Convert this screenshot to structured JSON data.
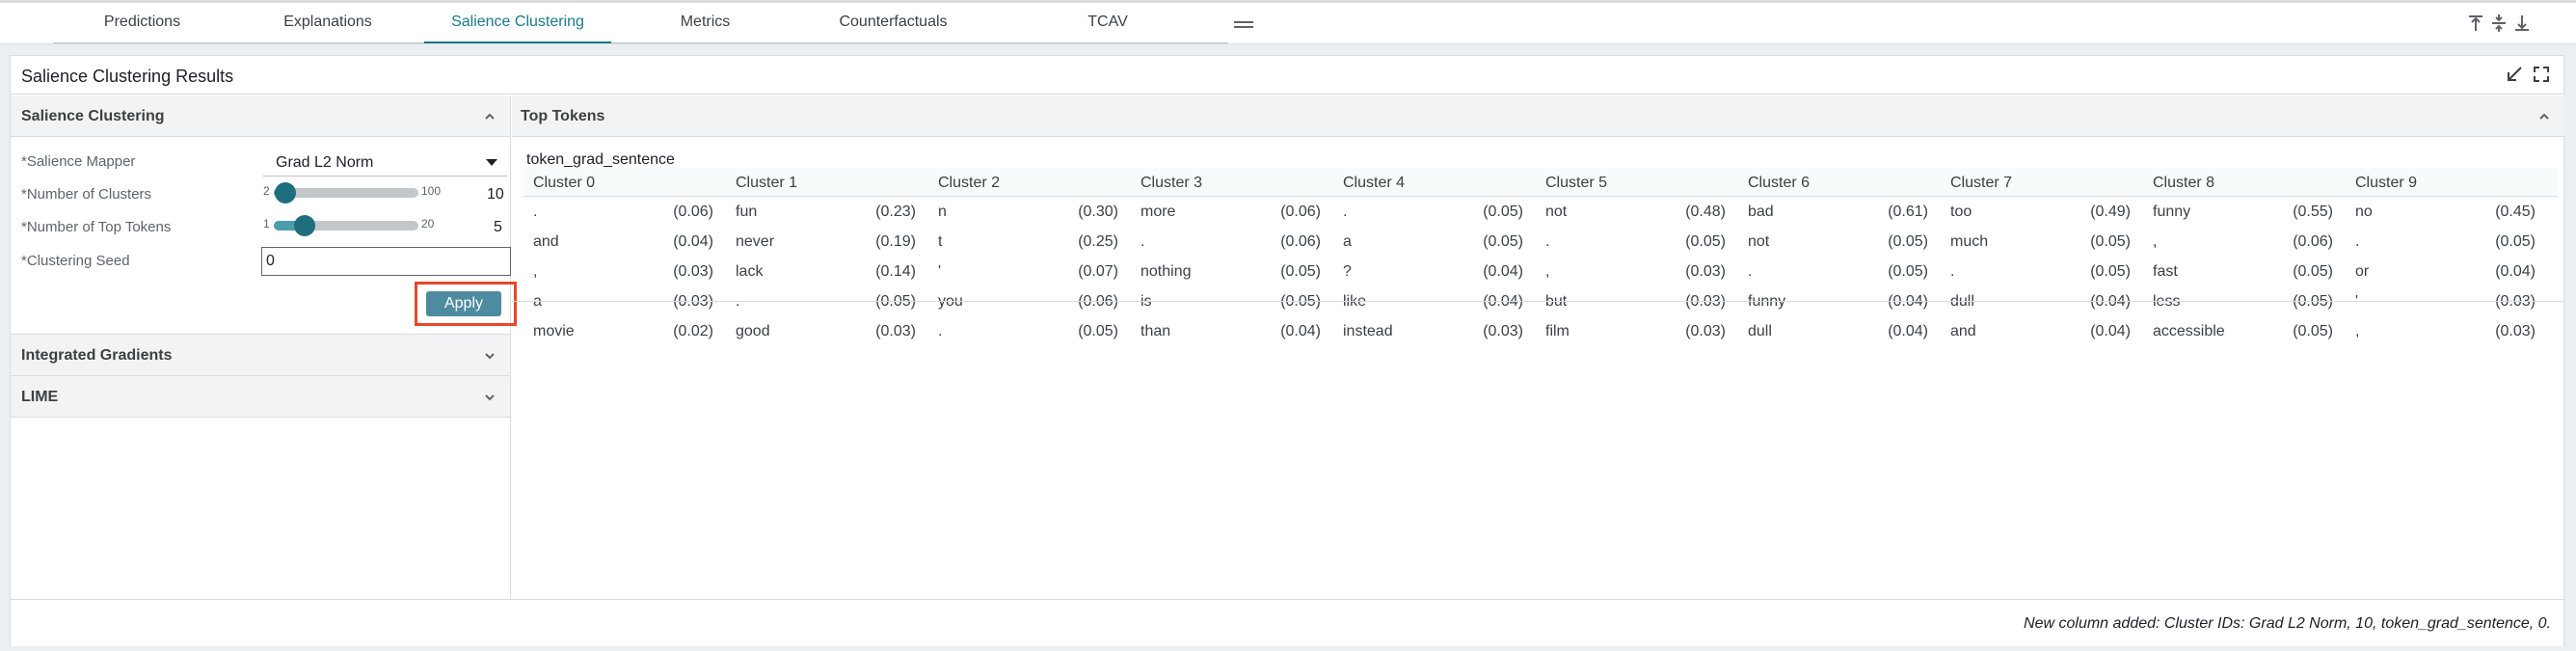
{
  "tabs": [
    "Predictions",
    "Explanations",
    "Salience Clustering",
    "Metrics",
    "Counterfactuals",
    "TCAV"
  ],
  "active_tab": "Salience Clustering",
  "module": {
    "title": "Salience Clustering Results"
  },
  "left": {
    "section_salience": "Salience Clustering",
    "mapper_label": "*Salience Mapper",
    "mapper_value": "Grad L2 Norm",
    "clusters_label": "*Number of Clusters",
    "clusters_min": "2",
    "clusters_max": "100",
    "clusters_value": "10",
    "clusters_fraction": 0.08,
    "tokens_label": "*Number of Top Tokens",
    "tokens_min": "1",
    "tokens_max": "20",
    "tokens_value": "5",
    "tokens_fraction": 0.21,
    "seed_label": "*Clustering Seed",
    "seed_value": "0",
    "apply_label": "Apply",
    "section_ig": "Integrated Gradients",
    "section_lime": "LIME"
  },
  "right": {
    "section_title": "Top Tokens",
    "field_name": "token_grad_sentence",
    "clusters": [
      "Cluster 0",
      "Cluster 1",
      "Cluster 2",
      "Cluster 3",
      "Cluster 4",
      "Cluster 5",
      "Cluster 6",
      "Cluster 7",
      "Cluster 8",
      "Cluster 9"
    ],
    "rows": [
      [
        [
          ".",
          "(0.06)"
        ],
        [
          "fun",
          "(0.23)"
        ],
        [
          "n",
          "(0.30)"
        ],
        [
          "more",
          "(0.06)"
        ],
        [
          ".",
          "(0.05)"
        ],
        [
          "not",
          "(0.48)"
        ],
        [
          "bad",
          "(0.61)"
        ],
        [
          "too",
          "(0.49)"
        ],
        [
          "funny",
          "(0.55)"
        ],
        [
          "no",
          "(0.45)"
        ]
      ],
      [
        [
          "and",
          "(0.04)"
        ],
        [
          "never",
          "(0.19)"
        ],
        [
          "t",
          "(0.25)"
        ],
        [
          ".",
          "(0.06)"
        ],
        [
          "a",
          "(0.05)"
        ],
        [
          ".",
          "(0.05)"
        ],
        [
          "not",
          "(0.05)"
        ],
        [
          "much",
          "(0.05)"
        ],
        [
          ",",
          "(0.06)"
        ],
        [
          ".",
          "(0.05)"
        ]
      ],
      [
        [
          ",",
          "(0.03)"
        ],
        [
          "lack",
          "(0.14)"
        ],
        [
          "'",
          "(0.07)"
        ],
        [
          "nothing",
          "(0.05)"
        ],
        [
          "?",
          "(0.04)"
        ],
        [
          ",",
          "(0.03)"
        ],
        [
          ".",
          "(0.05)"
        ],
        [
          ".",
          "(0.05)"
        ],
        [
          "fast",
          "(0.05)"
        ],
        [
          "or",
          "(0.04)"
        ]
      ],
      [
        [
          "a",
          "(0.03)"
        ],
        [
          ".",
          "(0.05)"
        ],
        [
          "you",
          "(0.06)"
        ],
        [
          "is",
          "(0.05)"
        ],
        [
          "like",
          "(0.04)"
        ],
        [
          "but",
          "(0.03)"
        ],
        [
          "funny",
          "(0.04)"
        ],
        [
          "dull",
          "(0.04)"
        ],
        [
          "less",
          "(0.05)"
        ],
        [
          "'",
          "(0.03)"
        ]
      ],
      [
        [
          "movie",
          "(0.02)"
        ],
        [
          "good",
          "(0.03)"
        ],
        [
          ".",
          "(0.05)"
        ],
        [
          "than",
          "(0.04)"
        ],
        [
          "instead",
          "(0.03)"
        ],
        [
          "film",
          "(0.03)"
        ],
        [
          "dull",
          "(0.04)"
        ],
        [
          "and",
          "(0.04)"
        ],
        [
          "accessible",
          "(0.05)"
        ],
        [
          ",",
          "(0.03)"
        ]
      ]
    ]
  },
  "status": "New column added: Cluster IDs: Grad L2 Norm, 10, token_grad_sentence, 0.",
  "colors": {
    "accent": "#1a7a8a",
    "apply_button": "#4f8ba0",
    "highlight_box": "#e8472a"
  },
  "icons": [
    "menu-drag-icon",
    "align-top-icon",
    "align-middle-icon",
    "align-bottom-icon",
    "minimize-icon",
    "fullscreen-icon",
    "chevron-up-icon",
    "chevron-down-icon",
    "dropdown-caret-icon"
  ]
}
